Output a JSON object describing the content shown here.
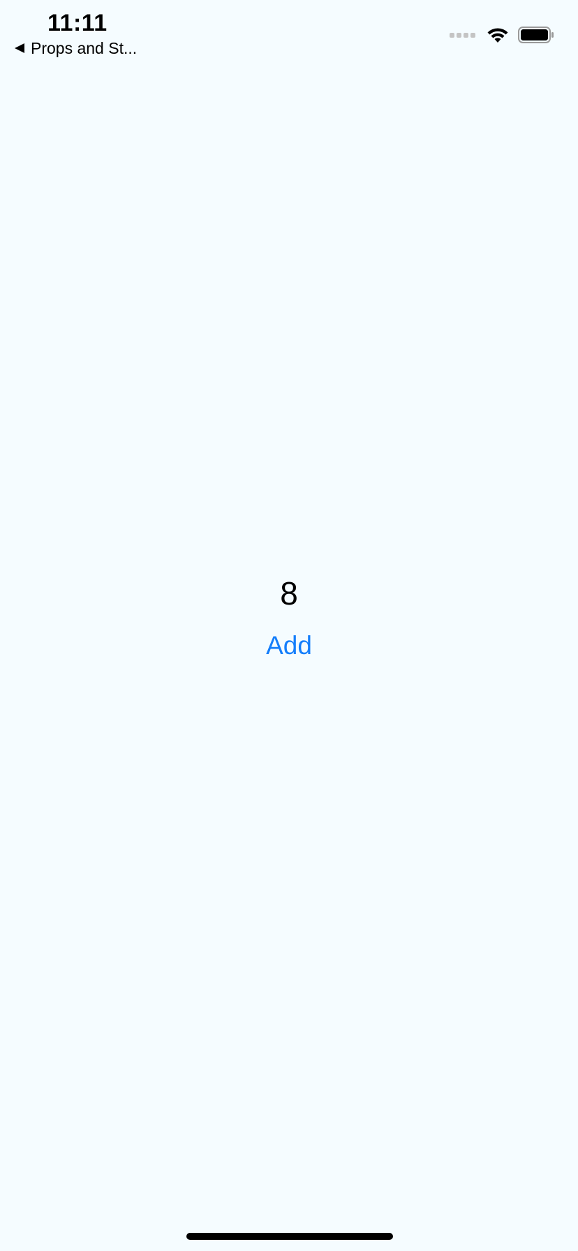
{
  "status_bar": {
    "time": "11:11",
    "back_label": "Props and St..."
  },
  "main": {
    "counter_value": "8",
    "add_button_label": "Add"
  },
  "colors": {
    "background": "#f5fcff",
    "accent": "#147efb",
    "text": "#000000"
  },
  "icons": {
    "back": "back-arrow-icon",
    "signal": "signal-icon",
    "wifi": "wifi-icon",
    "battery": "battery-icon"
  }
}
